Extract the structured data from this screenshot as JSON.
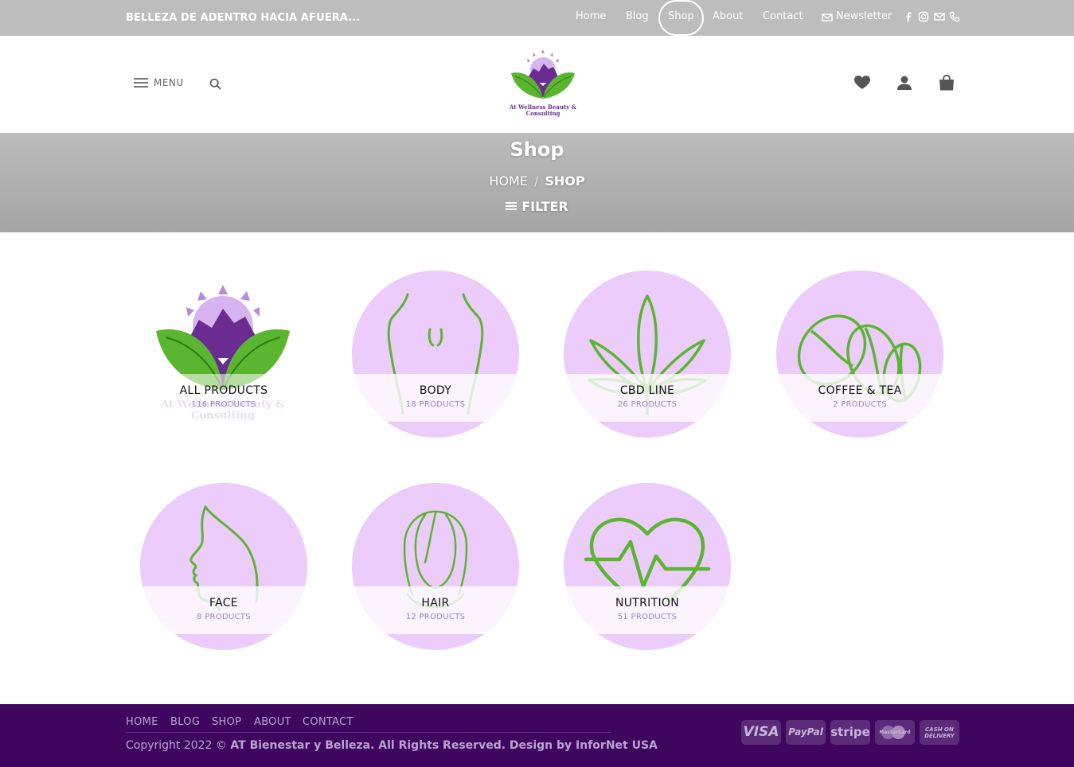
{
  "topbar": {
    "tagline": "BELLEZA DE ADENTRO HACIA AFUERA...",
    "nav": [
      "Home",
      "Blog",
      "Shop",
      "About",
      "Contact"
    ],
    "newsletter": "Newsletter",
    "social_icons": [
      "facebook-icon",
      "instagram-icon",
      "email-icon",
      "phone-icon"
    ]
  },
  "header": {
    "menu_label": "MENU",
    "logo_text": "At Wellness Beauty & Consulting",
    "icons": [
      "heart-icon",
      "user-icon",
      "cart-icon"
    ]
  },
  "titleband": {
    "title": "Shop",
    "crumb_home": "HOME",
    "crumb_sep": "/",
    "crumb_current": "SHOP",
    "filter": "FILTER"
  },
  "categories": [
    {
      "name": "ALL PRODUCTS",
      "count": "116 PRODUCTS"
    },
    {
      "name": "BODY",
      "count": "18 PRODUCTS"
    },
    {
      "name": "CBD LINE",
      "count": "26 PRODUCTS"
    },
    {
      "name": "COFFEE & TEA",
      "count": "2 PRODUCTS"
    },
    {
      "name": "FACE",
      "count": "8 PRODUCTS"
    },
    {
      "name": "HAIR",
      "count": "12 PRODUCTS"
    },
    {
      "name": "NUTRITION",
      "count": "51 PRODUCTS"
    }
  ],
  "footer": {
    "nav": [
      "HOME",
      "BLOG",
      "SHOP",
      "ABOUT",
      "CONTACT"
    ],
    "copyright_prefix": "Copyright 2022 ©",
    "copyright_bold": "AT Bienestar y Belleza. All Rights Reserved. Design by InforNet USA",
    "payments": [
      "VISA",
      "PayPal",
      "stripe",
      "MasterCard",
      "CASH ON DELIVERY"
    ]
  },
  "colors": {
    "topbar": "#bdbdbd",
    "circle": "#ecccfb",
    "green": "#5cb531",
    "purple": "#6a2c91",
    "footer": "#3f0660"
  }
}
